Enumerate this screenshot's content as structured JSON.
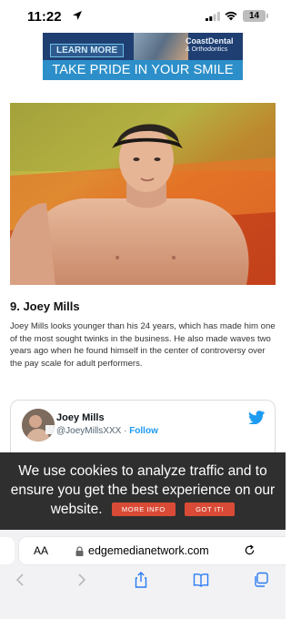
{
  "status_bar": {
    "time": "11:22",
    "battery": "14",
    "icons": [
      "location-arrow-icon",
      "signal-icon",
      "wifi-icon",
      "battery-icon"
    ]
  },
  "ad": {
    "learn_more": "LEARN MORE",
    "brand_line1": "CoastDental",
    "brand_line2": "& Orthodontics",
    "tagline": "TAKE PRIDE IN YOUR SMILE"
  },
  "article": {
    "heading": "9. Joey Mills",
    "body": "Joey Mills looks younger than his 24 years, which has made him one of the most sought twinks in the business. He also made waves two years ago when he found himself in the center of controversy over the pay scale for adult performers."
  },
  "tweet": {
    "name": "Joey Mills",
    "handle": "@JoeyMillsXXX",
    "separator": "·",
    "follow": "Follow"
  },
  "cookie": {
    "message": "We use cookies to analyze traffic and to ensure you get the best experience on our website.",
    "more_info": "MORE INFO",
    "got_it": "GOT IT!"
  },
  "browser": {
    "text_size": "AA",
    "url": "edgemedianetwork.com",
    "toolbar_icons": [
      "back-icon",
      "forward-icon",
      "share-icon",
      "bookmarks-icon",
      "tabs-icon"
    ]
  },
  "colors": {
    "cookie_button": "#d94b36",
    "twitter_blue": "#1d9bf0",
    "ad_navy": "#1f3e71",
    "ad_blue": "#2c8fc9"
  }
}
